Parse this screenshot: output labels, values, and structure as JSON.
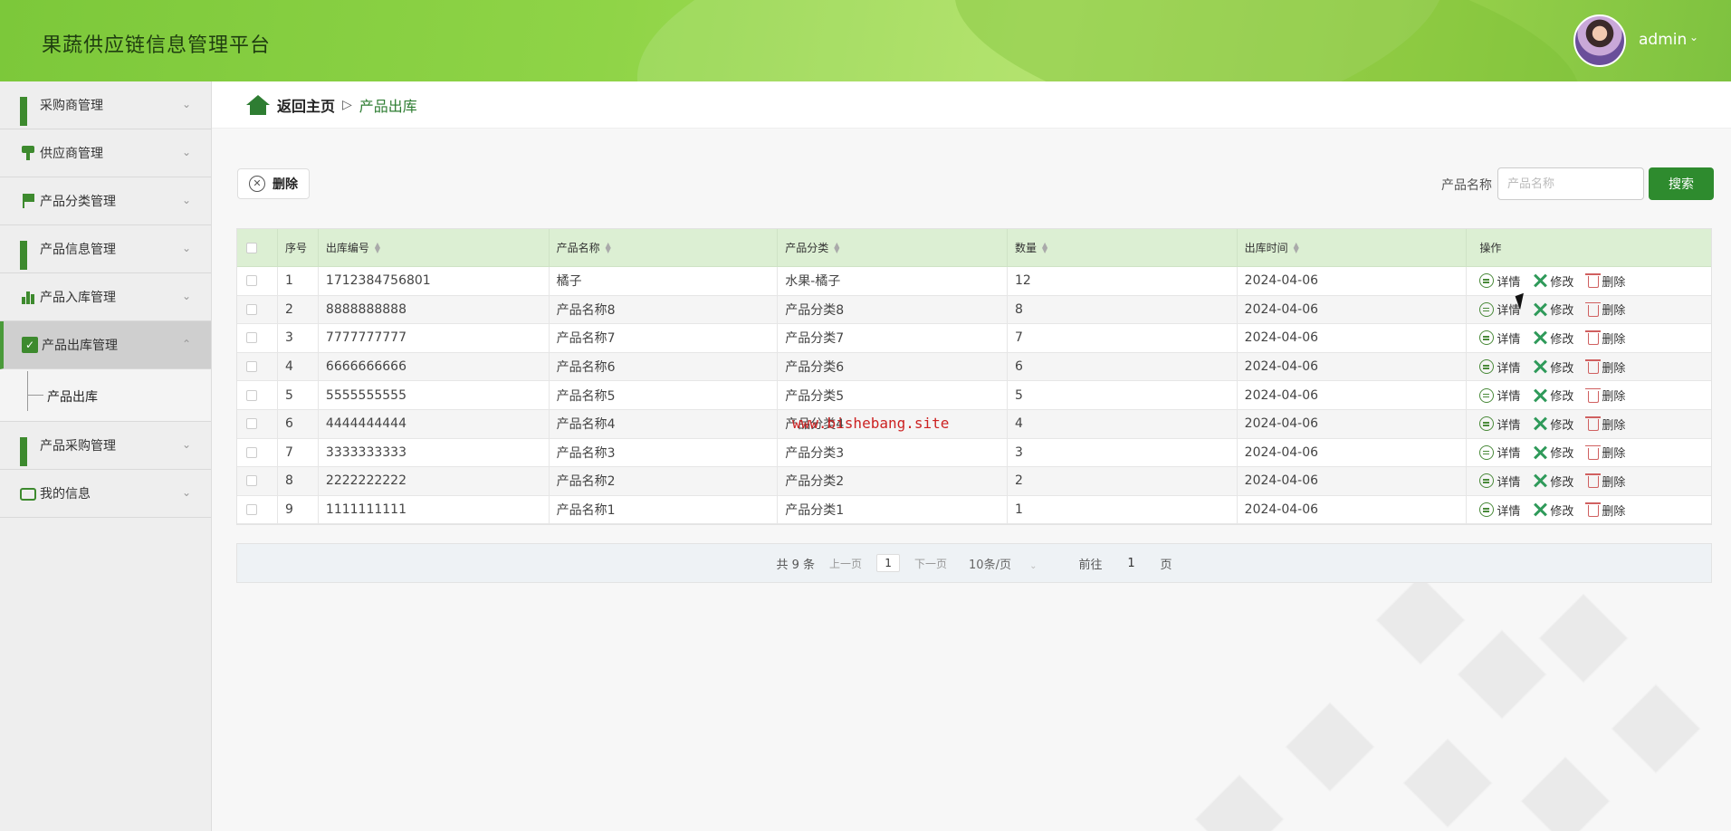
{
  "app": {
    "title": "果蔬供应链信息管理平台",
    "user": "admin",
    "caret": "⌄"
  },
  "sidebar": {
    "items": [
      {
        "label": "采购商管理",
        "icon": "grid-icon"
      },
      {
        "label": "供应商管理",
        "icon": "stamp-icon"
      },
      {
        "label": "产品分类管理",
        "icon": "flag-icon"
      },
      {
        "label": "产品信息管理",
        "icon": "grid-icon"
      },
      {
        "label": "产品入库管理",
        "icon": "bar-chart-icon"
      },
      {
        "label": "产品出库管理",
        "icon": "check-icon",
        "expanded": true
      },
      {
        "label": "产品采购管理",
        "icon": "grid-icon"
      },
      {
        "label": "我的信息",
        "icon": "wallet-icon"
      }
    ],
    "submenu": {
      "label": "产品出库"
    }
  },
  "breadcrumb": {
    "home": "返回主页",
    "sep": "▷",
    "current": "产品出库"
  },
  "toolbar": {
    "delete_label": "删除",
    "search_label": "产品名称",
    "search_placeholder": "产品名称",
    "search_button": "搜索"
  },
  "table": {
    "headers": [
      "序号",
      "出库编号",
      "产品名称",
      "产品分类",
      "数量",
      "出库时间",
      "操作"
    ],
    "rows": [
      [
        "1",
        "1712384756801",
        "橘子",
        "水果-橘子",
        "12",
        "2024-04-06"
      ],
      [
        "2",
        "8888888888",
        "产品名称8",
        "产品分类8",
        "8",
        "2024-04-06"
      ],
      [
        "3",
        "7777777777",
        "产品名称7",
        "产品分类7",
        "7",
        "2024-04-06"
      ],
      [
        "4",
        "6666666666",
        "产品名称6",
        "产品分类6",
        "6",
        "2024-04-06"
      ],
      [
        "5",
        "5555555555",
        "产品名称5",
        "产品分类5",
        "5",
        "2024-04-06"
      ],
      [
        "6",
        "4444444444",
        "产品名称4",
        "产品分类4",
        "4",
        "2024-04-06"
      ],
      [
        "7",
        "3333333333",
        "产品名称3",
        "产品分类3",
        "3",
        "2024-04-06"
      ],
      [
        "8",
        "2222222222",
        "产品名称2",
        "产品分类2",
        "2",
        "2024-04-06"
      ],
      [
        "9",
        "1111111111",
        "产品名称1",
        "产品分类1",
        "1",
        "2024-04-06"
      ]
    ],
    "actions": {
      "view": "详情",
      "edit": "修改",
      "delete": "删除"
    }
  },
  "pagination": {
    "total": "共 9 条",
    "prev": "上一页",
    "page": "1",
    "next": "下一页",
    "page_size": "10条/页",
    "goto": "前往",
    "goto_value": "1",
    "page_unit": "页"
  },
  "watermark": "www.bishebang.site",
  "colors": {
    "primary": "#2e8b2e",
    "header_green": "#8fd447",
    "table_head": "#dcefd3"
  }
}
